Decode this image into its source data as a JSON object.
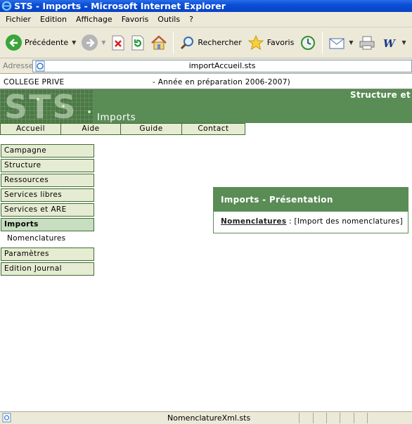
{
  "window": {
    "title": "STS - Imports - Microsoft Internet Explorer"
  },
  "menu": {
    "items": [
      "Fichier",
      "Edition",
      "Affichage",
      "Favoris",
      "Outils",
      "?"
    ]
  },
  "toolbar": {
    "back_label": "Précédente",
    "search_label": "Rechercher",
    "favorites_label": "Favoris"
  },
  "address": {
    "label": "Adresse",
    "value": "importAccueil.sts"
  },
  "header": {
    "college": "COLLEGE PRIVE",
    "annee": "- Année en préparation 2006-2007)"
  },
  "banner": {
    "logo_text": "STS",
    "structure": "Structure et",
    "section": "Imports",
    "colors": {
      "banner": "#5a8c55",
      "tab_bg": "#e6ecd2",
      "border": "#3f6b35"
    }
  },
  "tabs": [
    "Accueil",
    "Aide",
    "Guide",
    "Contact"
  ],
  "sidebar": {
    "items": [
      "Campagne",
      "Structure",
      "Ressources",
      "Services libres",
      "Services et ARE",
      "Imports",
      "Nomenclatures",
      "Paramètres",
      "Edition Journal"
    ],
    "active": "Imports",
    "sub_item": "Nomenclatures"
  },
  "panel": {
    "title": "Imports - Présentation",
    "link": "Nomenclatures",
    "link_suffix": " : [Import des nomenclatures]"
  },
  "status": {
    "text": "NomenclatureXml.sts"
  }
}
